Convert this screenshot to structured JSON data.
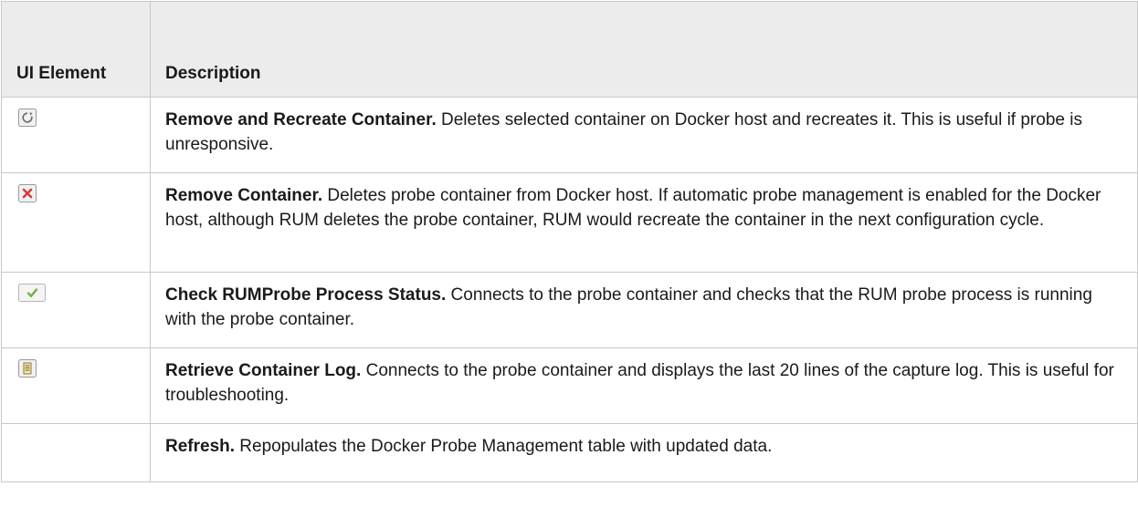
{
  "table": {
    "headers": {
      "ui_element": "UI Element",
      "description": "Description"
    },
    "rows": [
      {
        "icon": "recreate-icon",
        "title": "Remove and Recreate Container.",
        "text": " Deletes selected container on Docker host and recreates it. This is useful if probe is unresponsive."
      },
      {
        "icon": "remove-icon",
        "title": "Remove Container.",
        "text": " Deletes probe container from Docker host. If automatic probe management is enabled for the Docker host, although RUM deletes the probe container, RUM would recreate the container in the next configuration cycle."
      },
      {
        "icon": "check-status-icon",
        "title": "Check RUMProbe Process Status.",
        "text": " Connects to the probe container and checks that the RUM probe process is running with the probe container."
      },
      {
        "icon": "log-icon",
        "title": "Retrieve Container Log.",
        "text": " Connects to the probe container and displays the last 20 lines of the capture log. This is useful for troubleshooting."
      },
      {
        "icon": "",
        "title": "Refresh.",
        "text": " Repopulates the Docker Probe Management table with updated data."
      }
    ]
  },
  "colors": {
    "header_bg": "#ececec",
    "border": "#c8c8c8",
    "icon_red": "#d83a3a",
    "icon_green": "#6bb33a"
  }
}
